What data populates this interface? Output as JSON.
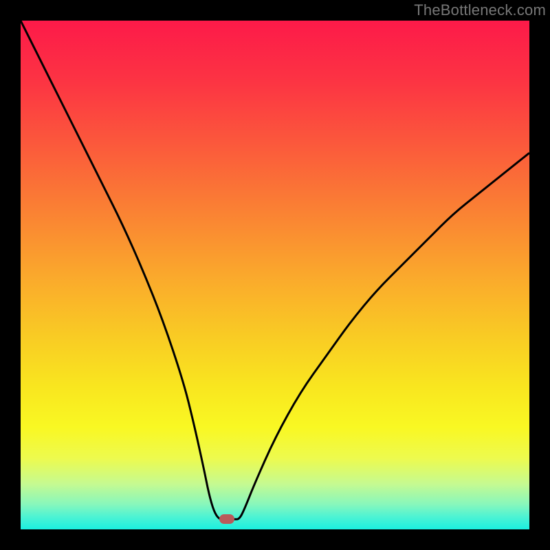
{
  "attribution": "TheBottleneck.com",
  "colors": {
    "marker": "#b95a5a",
    "curve": "#000000",
    "bg_black": "#000000"
  },
  "gradient_stops": [
    {
      "offset": 0.0,
      "color": "#fd1a49"
    },
    {
      "offset": 0.12,
      "color": "#fc3443"
    },
    {
      "offset": 0.25,
      "color": "#fb5b3b"
    },
    {
      "offset": 0.38,
      "color": "#fa8333"
    },
    {
      "offset": 0.5,
      "color": "#faa82c"
    },
    {
      "offset": 0.62,
      "color": "#f9cb24"
    },
    {
      "offset": 0.72,
      "color": "#f9e61f"
    },
    {
      "offset": 0.8,
      "color": "#f9f823"
    },
    {
      "offset": 0.86,
      "color": "#edfa4e"
    },
    {
      "offset": 0.91,
      "color": "#c6fa90"
    },
    {
      "offset": 0.95,
      "color": "#89f7bb"
    },
    {
      "offset": 0.975,
      "color": "#4df3d3"
    },
    {
      "offset": 1.0,
      "color": "#1bf0e0"
    }
  ],
  "chart_data": {
    "type": "line",
    "title": "",
    "xlabel": "",
    "ylabel": "",
    "xlim": [
      0,
      100
    ],
    "ylim": [
      0,
      100
    ],
    "grid": false,
    "legend": false,
    "x": [
      0,
      4,
      8,
      12,
      16,
      20,
      24,
      28,
      32,
      34,
      36,
      37,
      38,
      39,
      40,
      41,
      42,
      43,
      44,
      46,
      50,
      55,
      60,
      65,
      70,
      75,
      80,
      85,
      90,
      95,
      100
    ],
    "values": [
      100,
      92,
      84,
      76,
      68,
      60,
      51,
      41,
      29,
      21,
      12,
      7,
      3.5,
      2,
      2,
      2,
      2,
      2,
      4,
      9,
      18,
      27,
      34,
      41,
      47,
      52,
      57,
      62,
      66,
      70,
      74
    ],
    "marker": {
      "x": 40.5,
      "y": 2
    },
    "notes": "Single curve showing a V-shape dip; minimum (bottleneck point) near x≈40.5. Values estimated from pixels; y read as 100 - pixel_height fraction. Right branch rises shallower than left."
  }
}
